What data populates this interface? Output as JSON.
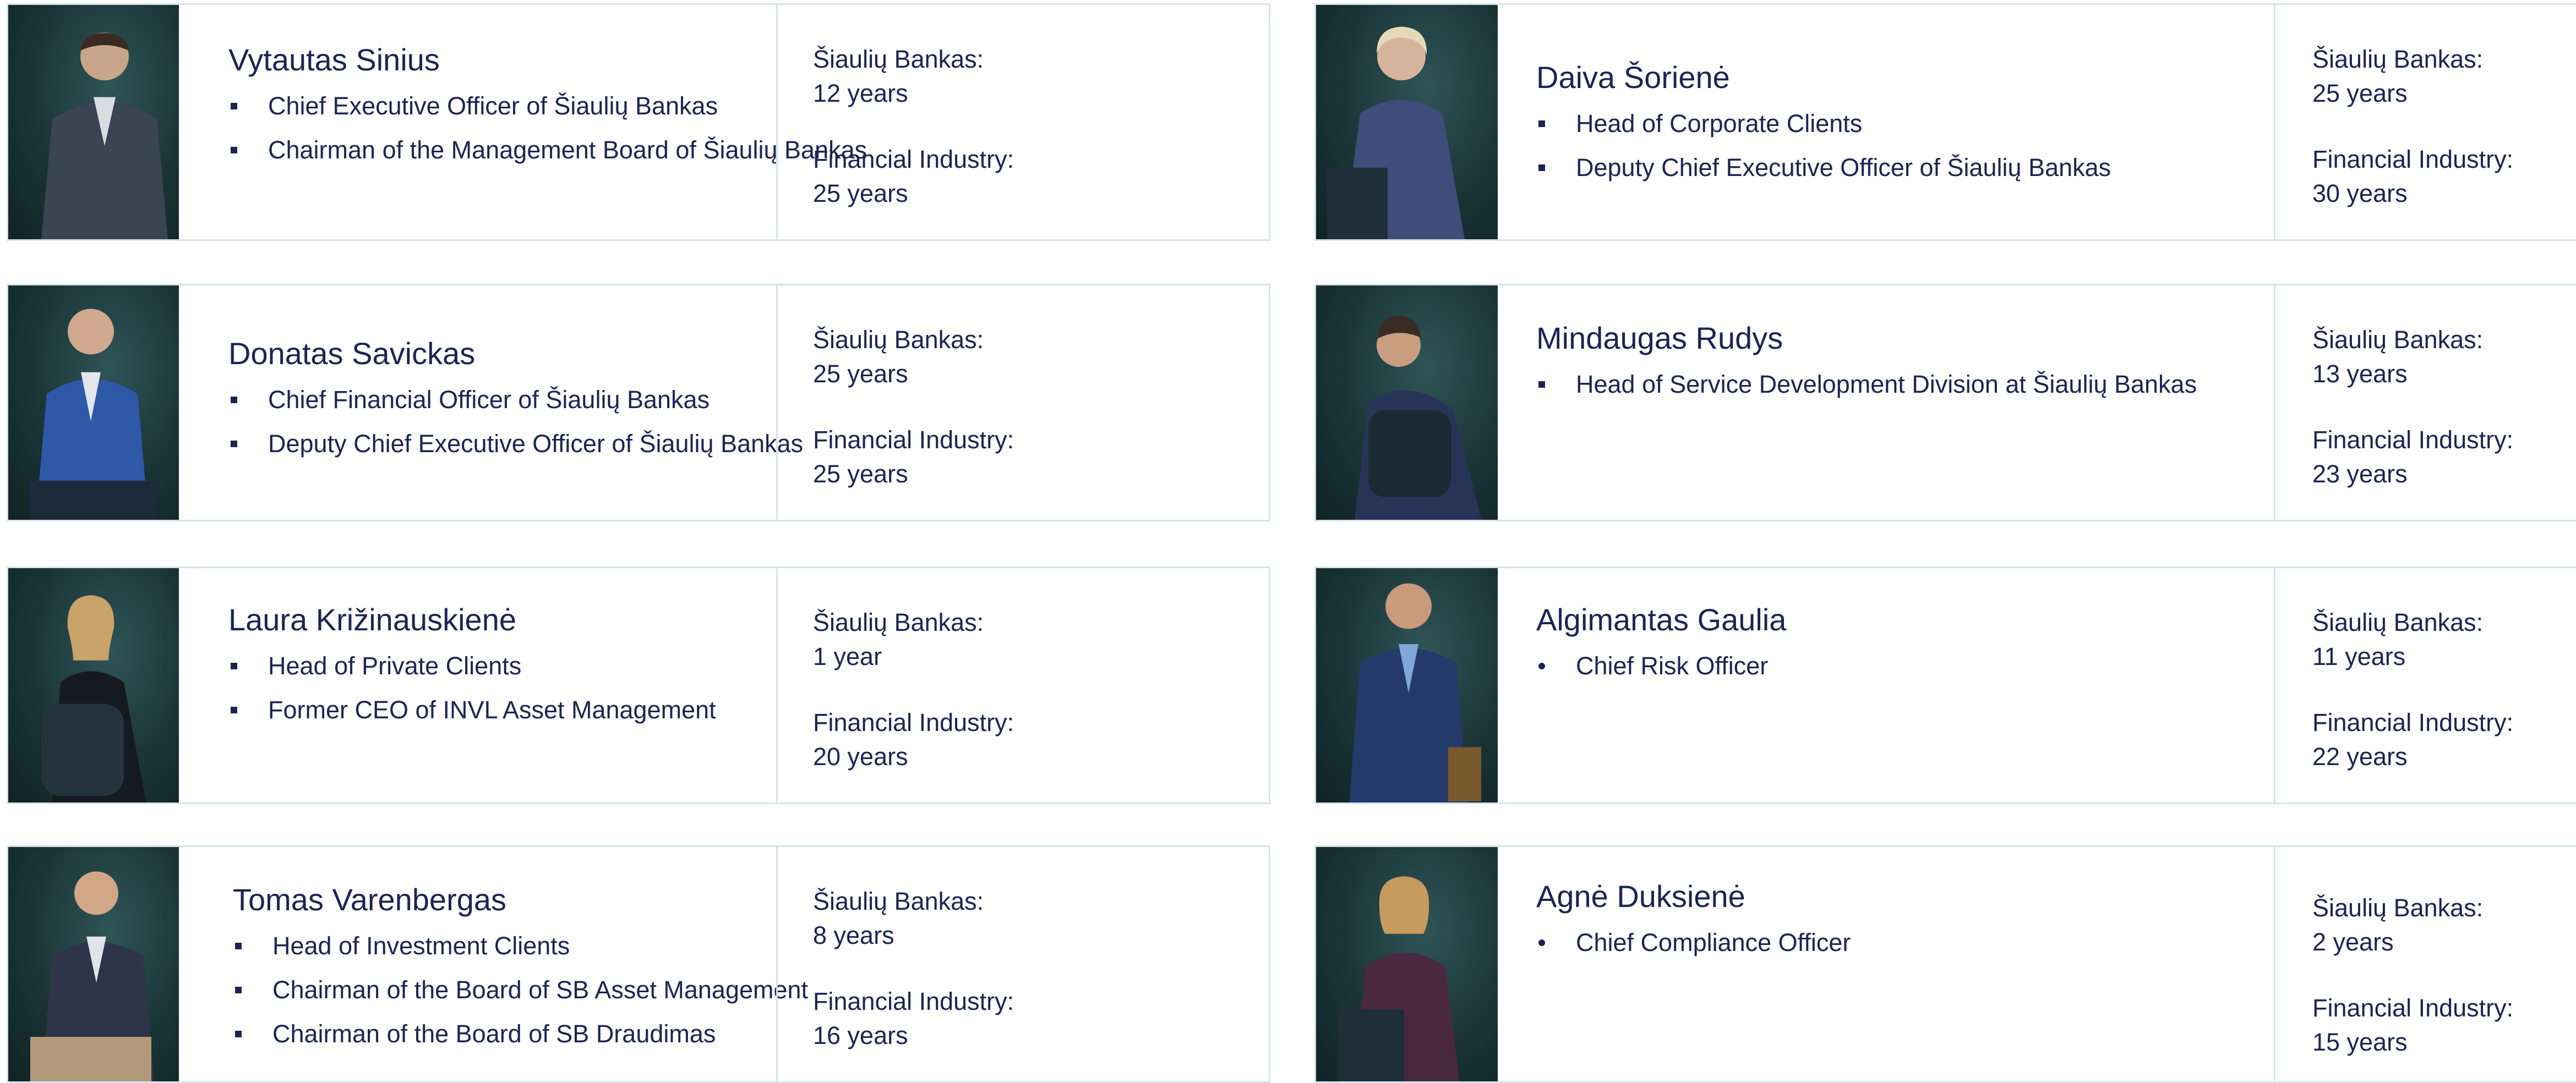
{
  "colors": {
    "text": "#1b2454",
    "border": "#d6e3ea",
    "photo_bg": "#1a3436"
  },
  "labels": {
    "bank": "Šiaulių Bankas:",
    "industry": "Financial Industry:"
  },
  "people": [
    {
      "name": "Vytautas Sinius",
      "bullet": "square",
      "roles": [
        "Chief Executive Officer of Šiaulių Bankas",
        "Chairman of the Management Board of Šiaulių Bankas"
      ],
      "bank_years": "12 years",
      "industry_years": "25 years"
    },
    {
      "name": "Daiva Šorienė",
      "bullet": "square",
      "roles": [
        "Head of Corporate Clients",
        "Deputy Chief Executive Officer of Šiaulių Bankas"
      ],
      "bank_years": "25 years",
      "industry_years": "30 years"
    },
    {
      "name": "Donatas Savickas",
      "bullet": "square",
      "roles": [
        "Chief Financial Officer of Šiaulių Bankas",
        "Deputy Chief Executive Officer of Šiaulių Bankas"
      ],
      "bank_years": "25 years",
      "industry_years": "25 years"
    },
    {
      "name": "Mindaugas Rudys",
      "bullet": "square",
      "roles": [
        "Head of Service Development Division at Šiaulių Bankas"
      ],
      "bank_years": "13 years",
      "industry_years": "23 years"
    },
    {
      "name": "Laura Križinauskienė",
      "bullet": "square",
      "roles": [
        "Head of Private Clients",
        "Former CEO of INVL Asset Management"
      ],
      "bank_years": "1 year",
      "industry_years": "20 years"
    },
    {
      "name": "Algimantas Gaulia",
      "bullet": "dot",
      "roles": [
        "Chief Risk Officer"
      ],
      "bank_years": "11 years",
      "industry_years": "22 years"
    },
    {
      "name": "Tomas Varenbergas",
      "bullet": "square",
      "roles": [
        "Head of Investment Clients",
        "Chairman of the Board of SB Asset Management",
        "Chairman of the Board of SB Draudimas"
      ],
      "bank_years": "8 years",
      "industry_years": "16 years"
    },
    {
      "name": "Agnė Duksienė",
      "bullet": "dot",
      "roles": [
        "Chief Compliance Officer"
      ],
      "bank_years": "2 years",
      "industry_years": "15 years"
    }
  ]
}
